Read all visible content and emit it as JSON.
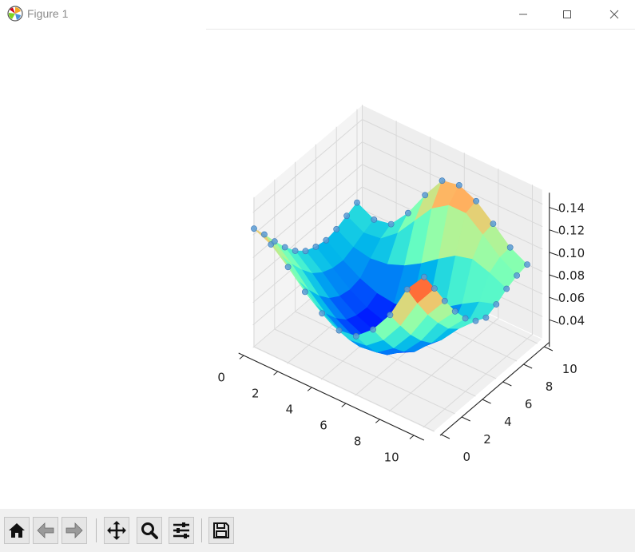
{
  "window": {
    "title": "Figure 1",
    "icons": [
      "matplotlib-logo-icon",
      "minimize-icon",
      "maximize-icon",
      "close-icon"
    ]
  },
  "toolbar": {
    "buttons": [
      {
        "name": "home-button",
        "icon": "home-icon"
      },
      {
        "name": "back-button",
        "icon": "arrow-left-icon"
      },
      {
        "name": "forward-button",
        "icon": "arrow-right-icon"
      },
      {
        "name": "pan-button",
        "icon": "move-icon"
      },
      {
        "name": "zoom-button",
        "icon": "magnifier-icon"
      },
      {
        "name": "configure-subplots-button",
        "icon": "sliders-icon"
      },
      {
        "name": "save-button",
        "icon": "floppy-disk-icon"
      }
    ]
  },
  "chart_data": {
    "type": "surface3d",
    "colormap": "rainbow",
    "markers": "scatter points at grid nodes (steelblue)",
    "x": [
      0,
      1,
      2,
      3,
      4,
      5,
      6,
      7,
      8,
      9,
      10
    ],
    "y": [
      0,
      1,
      2,
      3,
      4,
      5,
      6,
      7,
      8,
      9,
      10
    ],
    "xticks": [
      "0",
      "2",
      "4",
      "6",
      "8",
      "10"
    ],
    "yticks": [
      "0",
      "2",
      "4",
      "6",
      "8",
      "10"
    ],
    "zticks": [
      "0.04",
      "0.06",
      "0.08",
      "0.10",
      "0.12",
      "0.14"
    ],
    "xlim": [
      0,
      10
    ],
    "ylim": [
      0,
      10
    ],
    "zlim": [
      0.02,
      0.15
    ],
    "grid": true,
    "z": [
      [
        0.125,
        0.118,
        0.105,
        0.09,
        0.078,
        0.07,
        0.072,
        0.085,
        0.105,
        0.135,
        0.153
      ],
      [
        0.112,
        0.1,
        0.085,
        0.071,
        0.06,
        0.054,
        0.056,
        0.068,
        0.088,
        0.115,
        0.135
      ],
      [
        0.098,
        0.085,
        0.069,
        0.055,
        0.045,
        0.04,
        0.042,
        0.053,
        0.072,
        0.097,
        0.116
      ],
      [
        0.085,
        0.072,
        0.056,
        0.043,
        0.034,
        0.03,
        0.032,
        0.042,
        0.059,
        0.082,
        0.099
      ],
      [
        0.074,
        0.061,
        0.046,
        0.034,
        0.027,
        0.024,
        0.026,
        0.034,
        0.049,
        0.069,
        0.085
      ],
      [
        0.066,
        0.054,
        0.04,
        0.03,
        0.024,
        0.022,
        0.024,
        0.031,
        0.044,
        0.061,
        0.075
      ],
      [
        0.062,
        0.05,
        0.038,
        0.029,
        0.024,
        0.023,
        0.026,
        0.034,
        0.046,
        0.06,
        0.07
      ],
      [
        0.06,
        0.049,
        0.04,
        0.034,
        0.032,
        0.034,
        0.04,
        0.05,
        0.06,
        0.069,
        0.074
      ],
      [
        0.062,
        0.053,
        0.05,
        0.052,
        0.058,
        0.067,
        0.078,
        0.088,
        0.092,
        0.087,
        0.08
      ],
      [
        0.066,
        0.058,
        0.06,
        0.072,
        0.09,
        0.108,
        0.118,
        0.118,
        0.106,
        0.093,
        0.084
      ],
      [
        0.07,
        0.062,
        0.065,
        0.082,
        0.105,
        0.125,
        0.128,
        0.121,
        0.108,
        0.094,
        0.086
      ]
    ]
  }
}
